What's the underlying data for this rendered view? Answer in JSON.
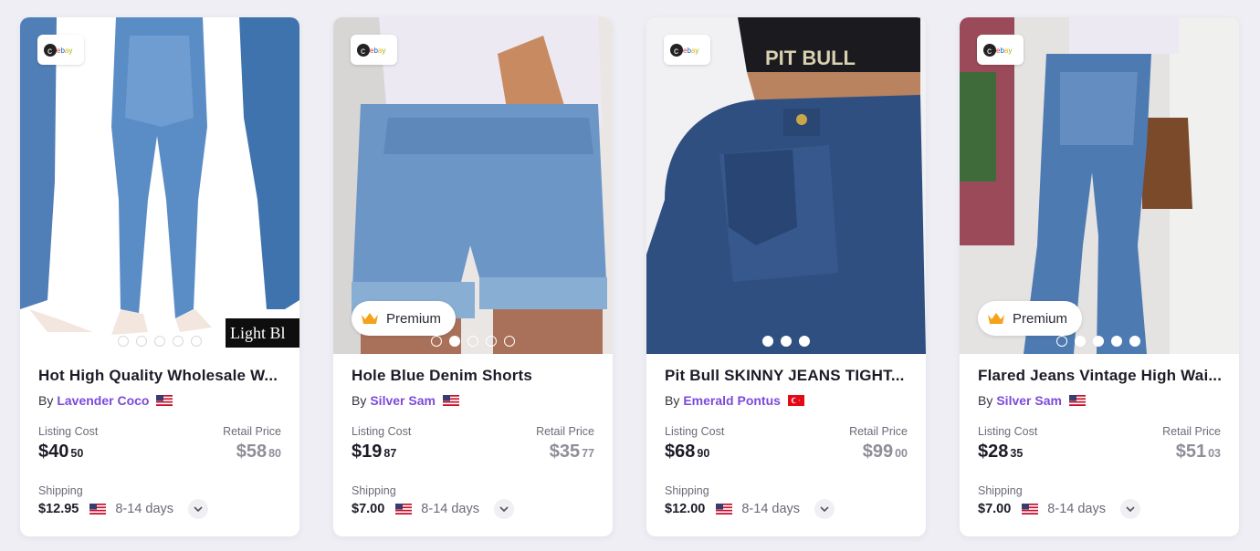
{
  "badges": {
    "marketplace_icon": "ebay-logo-icon",
    "premium_label": "Premium",
    "premium_icon": "crown-icon"
  },
  "labels": {
    "by": "By",
    "listing_cost": "Listing Cost",
    "retail_price": "Retail Price",
    "shipping": "Shipping"
  },
  "colors": {
    "seller_link": "#7b4bdb",
    "premium_crown": "#f5a21b",
    "background": "#eeeef4"
  },
  "products": [
    {
      "title": "Hot High Quality Wholesale W...",
      "seller": "Lavender Coco",
      "flag": "us-flag-icon",
      "listing_dollars": "$40",
      "listing_cents": "50",
      "retail_dollars": "$58",
      "retail_cents": "80",
      "shipping_price": "$12.95",
      "shipping_flag": "us-flag-icon",
      "shipping_days": "8-14 days",
      "premium": false,
      "image_text": "Light Bl",
      "dots": 5,
      "active_dot": 0
    },
    {
      "title": "Hole Blue Denim Shorts",
      "seller": "Silver Sam",
      "flag": "us-flag-icon",
      "listing_dollars": "$19",
      "listing_cents": "87",
      "retail_dollars": "$35",
      "retail_cents": "77",
      "shipping_price": "$7.00",
      "shipping_flag": "us-flag-icon",
      "shipping_days": "8-14 days",
      "premium": true,
      "dots": 5,
      "active_dot": 1
    },
    {
      "title": "Pit Bull SKINNY JEANS TIGHT...",
      "seller": "Emerald Pontus",
      "flag": "turkey-flag-icon",
      "listing_dollars": "$68",
      "listing_cents": "90",
      "retail_dollars": "$99",
      "retail_cents": "00",
      "shipping_price": "$12.00",
      "shipping_flag": "us-flag-icon",
      "shipping_days": "8-14 days",
      "premium": false,
      "image_text": "PIT BULL",
      "dots": 3,
      "active_dot": 0
    },
    {
      "title": "Flared Jeans Vintage High Wai...",
      "seller": "Silver Sam",
      "flag": "us-flag-icon",
      "listing_dollars": "$28",
      "listing_cents": "35",
      "retail_dollars": "$51",
      "retail_cents": "03",
      "shipping_price": "$7.00",
      "shipping_flag": "us-flag-icon",
      "shipping_days": "8-14 days",
      "premium": true,
      "dots": 5,
      "active_dot": 1
    }
  ]
}
